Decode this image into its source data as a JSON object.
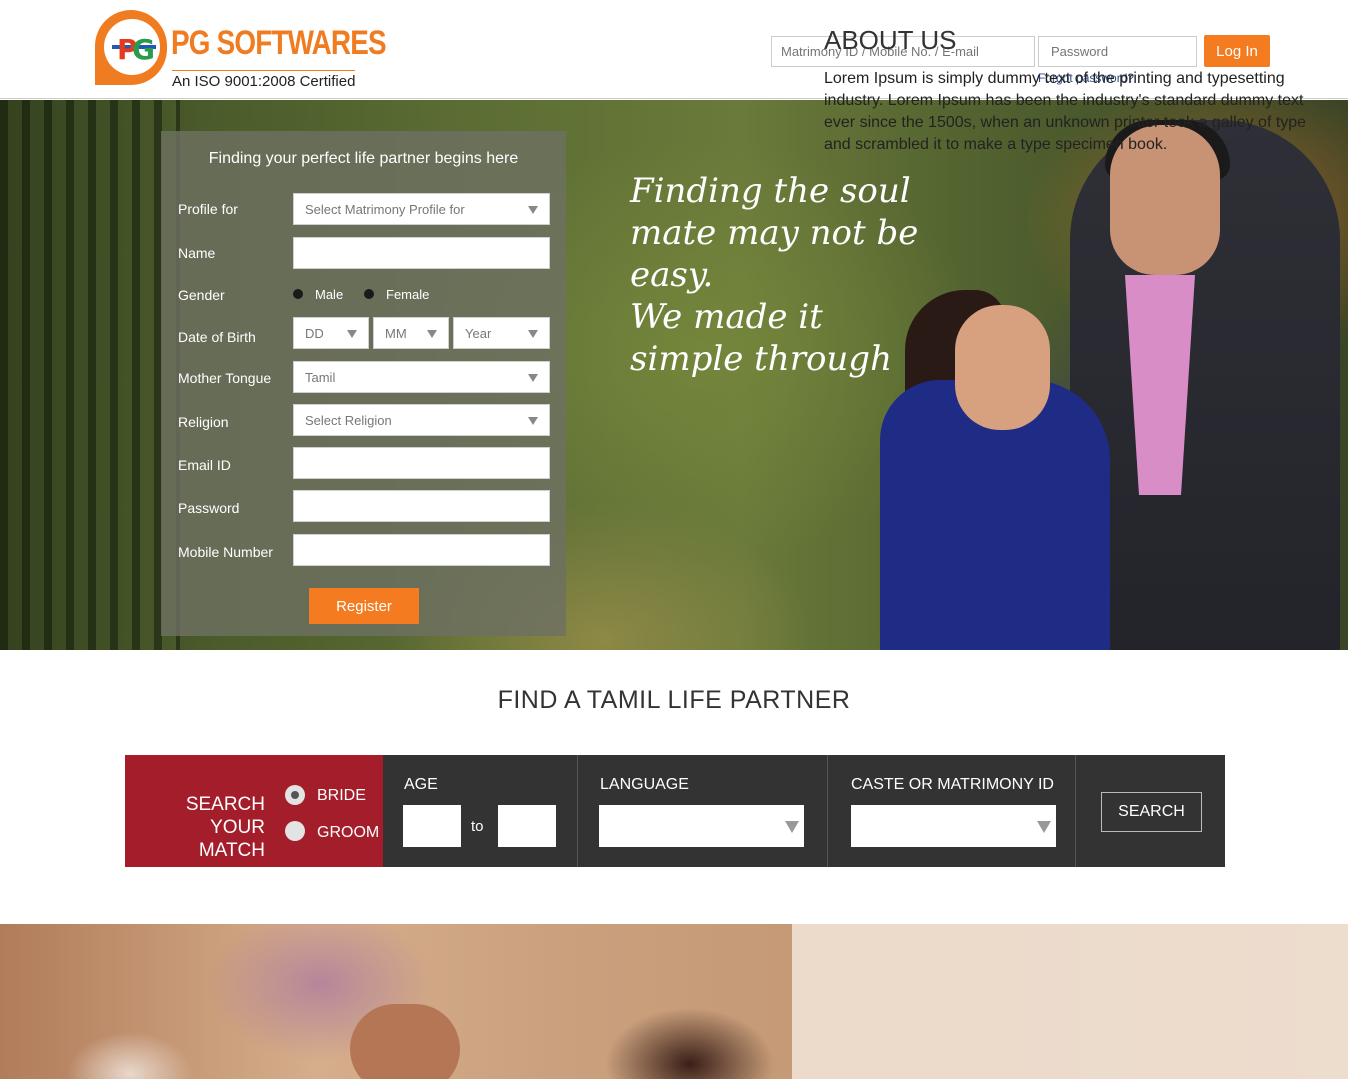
{
  "header": {
    "logo_title": "PG SOFTWARES",
    "logo_subtitle": "An ISO 9001:2008 Certified",
    "login_id_placeholder": "Matrimony ID / Mobile No. / E-mail",
    "login_password_placeholder": "Password",
    "login_button": "Log In",
    "forgot_password": "Forgot password?"
  },
  "hero": {
    "quote_lines": [
      "Finding the soul",
      "mate may not be",
      "easy.",
      "We made it",
      "simple through"
    ]
  },
  "register": {
    "title": "Finding your perfect life partner begins here",
    "profile_for_label": "Profile for",
    "profile_for_value": "Select Matrimony Profile for",
    "name_label": "Name",
    "gender_label": "Gender",
    "gender_male": "Male",
    "gender_female": "Female",
    "dob_label": "Date of Birth",
    "dob_day": "DD",
    "dob_month": "MM",
    "dob_year": "Year",
    "mother_tongue_label": "Mother Tongue",
    "mother_tongue_value": "Tamil",
    "religion_label": "Religion",
    "religion_value": "Select Religion",
    "email_label": "Email ID",
    "password_label": "Password",
    "mobile_label": "Mobile Number",
    "register_button": "Register"
  },
  "find": {
    "title": "FIND A TAMIL LIFE PARTNER",
    "search_your_match": [
      "SEARCH",
      "YOUR MATCH"
    ],
    "bride": "BRIDE",
    "groom": "GROOM",
    "selected": "BRIDE",
    "age_label": "AGE",
    "age_to": "to",
    "language_label": "LANGUAGE",
    "caste_label": "CASTE OR MATRIMONY ID",
    "search_button": "SEARCH"
  },
  "about": {
    "title": "ABOUT US",
    "body": "Lorem Ipsum is simply dummy text of the printing and typesetting industry. Lorem Ipsum has been the industry's standard dummy text ever since the 1500s, when an unknown printer took a galley of type and scrambled it to make a type specimen book."
  },
  "colors": {
    "brand_orange": "#f47b20",
    "search_red": "#a31d2b",
    "search_dark": "#333333"
  }
}
